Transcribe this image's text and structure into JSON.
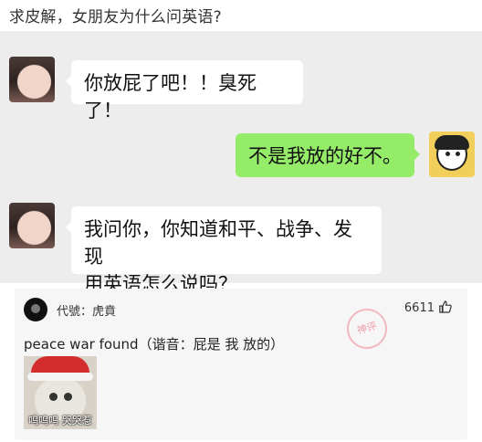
{
  "post": {
    "title": "求皮解，女朋友为什么问英语?"
  },
  "chat": {
    "messages": [
      {
        "side": "left",
        "text": "你放屁了吧！！臭死了！"
      },
      {
        "side": "right",
        "text": "不是我放的好不。"
      },
      {
        "side": "left",
        "text_line1": "我问你，你知道和平、战争、发现",
        "text_line2": "用英语怎么说吗？"
      }
    ]
  },
  "comment": {
    "user": "代號：虎賁",
    "likes": "6611",
    "text": "peace war found（谐音：屁是 我 放的）",
    "stamp_text": "神评",
    "meme_caption": "呜呜呜 哭哭惹"
  },
  "colors": {
    "chat_background": "#ededed",
    "sent_bubble": "#95ec69",
    "received_bubble": "#ffffff"
  },
  "icons": {
    "like": "thumb-up-icon"
  }
}
